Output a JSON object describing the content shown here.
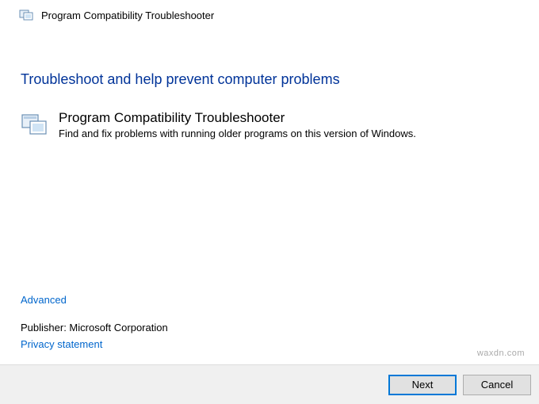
{
  "titlebar": {
    "title": "Program Compatibility Troubleshooter"
  },
  "main": {
    "heading": "Troubleshoot and help prevent computer problems",
    "troubleshooter": {
      "title": "Program Compatibility Troubleshooter",
      "description": "Find and fix problems with running older programs on this version of Windows."
    }
  },
  "footer": {
    "advanced_label": "Advanced",
    "publisher_prefix": "Publisher:  ",
    "publisher_name": "Microsoft Corporation",
    "privacy_label": "Privacy statement"
  },
  "buttons": {
    "next": "Next",
    "cancel": "Cancel"
  },
  "watermark": "waxdn.com"
}
